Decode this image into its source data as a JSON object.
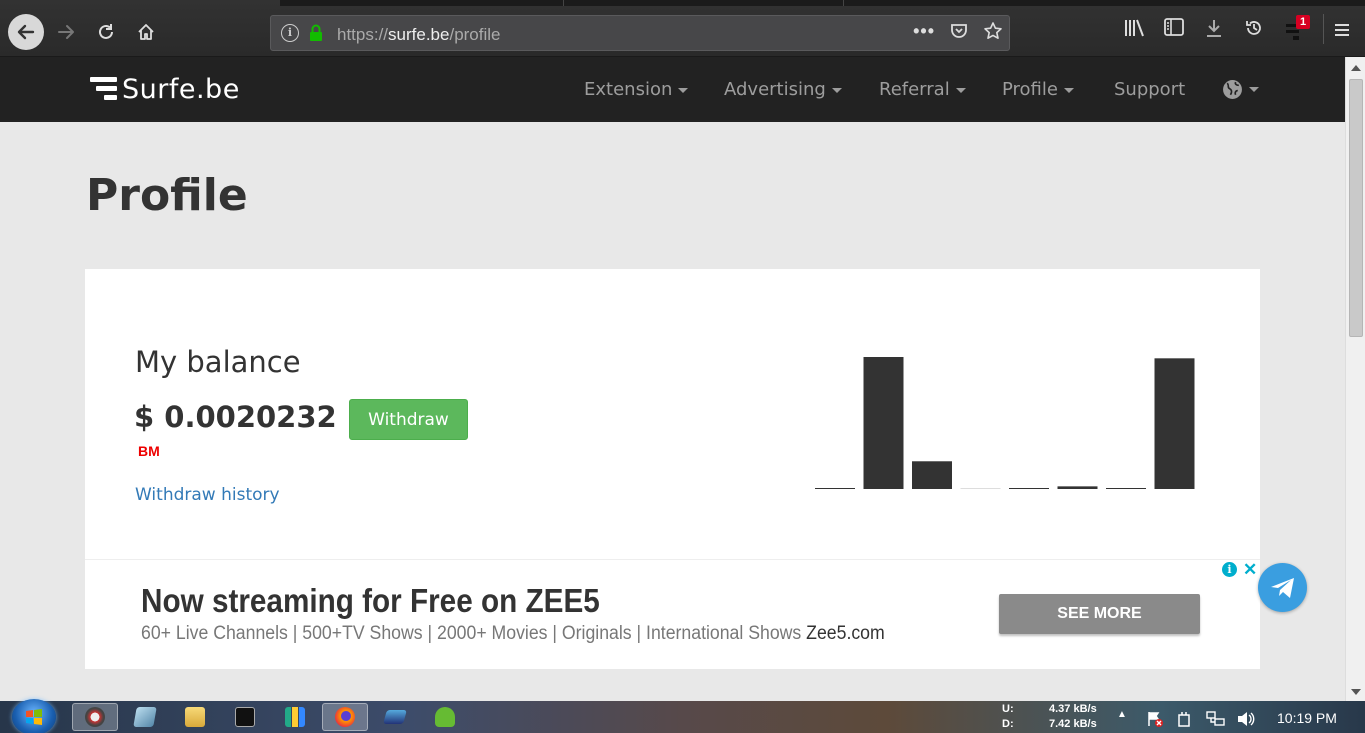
{
  "browser": {
    "url_scheme": "https://",
    "url_host": "surfe.be",
    "url_path": "/profile",
    "notification_count": "1"
  },
  "site": {
    "logo_text": "Surfe.be",
    "nav": [
      {
        "label": "Extension"
      },
      {
        "label": "Advertising"
      },
      {
        "label": "Referral"
      },
      {
        "label": "Profile"
      },
      {
        "label": "Support"
      }
    ]
  },
  "page": {
    "title": "Profile",
    "balance_title": "My balance",
    "balance_amount": "$ 0.0020232",
    "currency_tag": "BM",
    "withdraw_label": "Withdraw",
    "withdraw_history_label": "Withdraw history"
  },
  "chart_data": {
    "type": "bar",
    "values": [
      0.5,
      100,
      21,
      0,
      0.3,
      2,
      0.3,
      99
    ],
    "color": "#333333"
  },
  "ad": {
    "headline": "Now streaming for Free on ZEE5",
    "subtext": "60+ Live Channels | 500+TV Shows | 2000+ Movies | Originals | International Shows",
    "domain": "Zee5.com",
    "cta": "SEE MORE"
  },
  "taskbar": {
    "upload_label": "U:",
    "download_label": "D:",
    "upload_speed": "4.37 kB/s",
    "download_speed": "7.42 kB/s",
    "time": "10:19 PM"
  }
}
